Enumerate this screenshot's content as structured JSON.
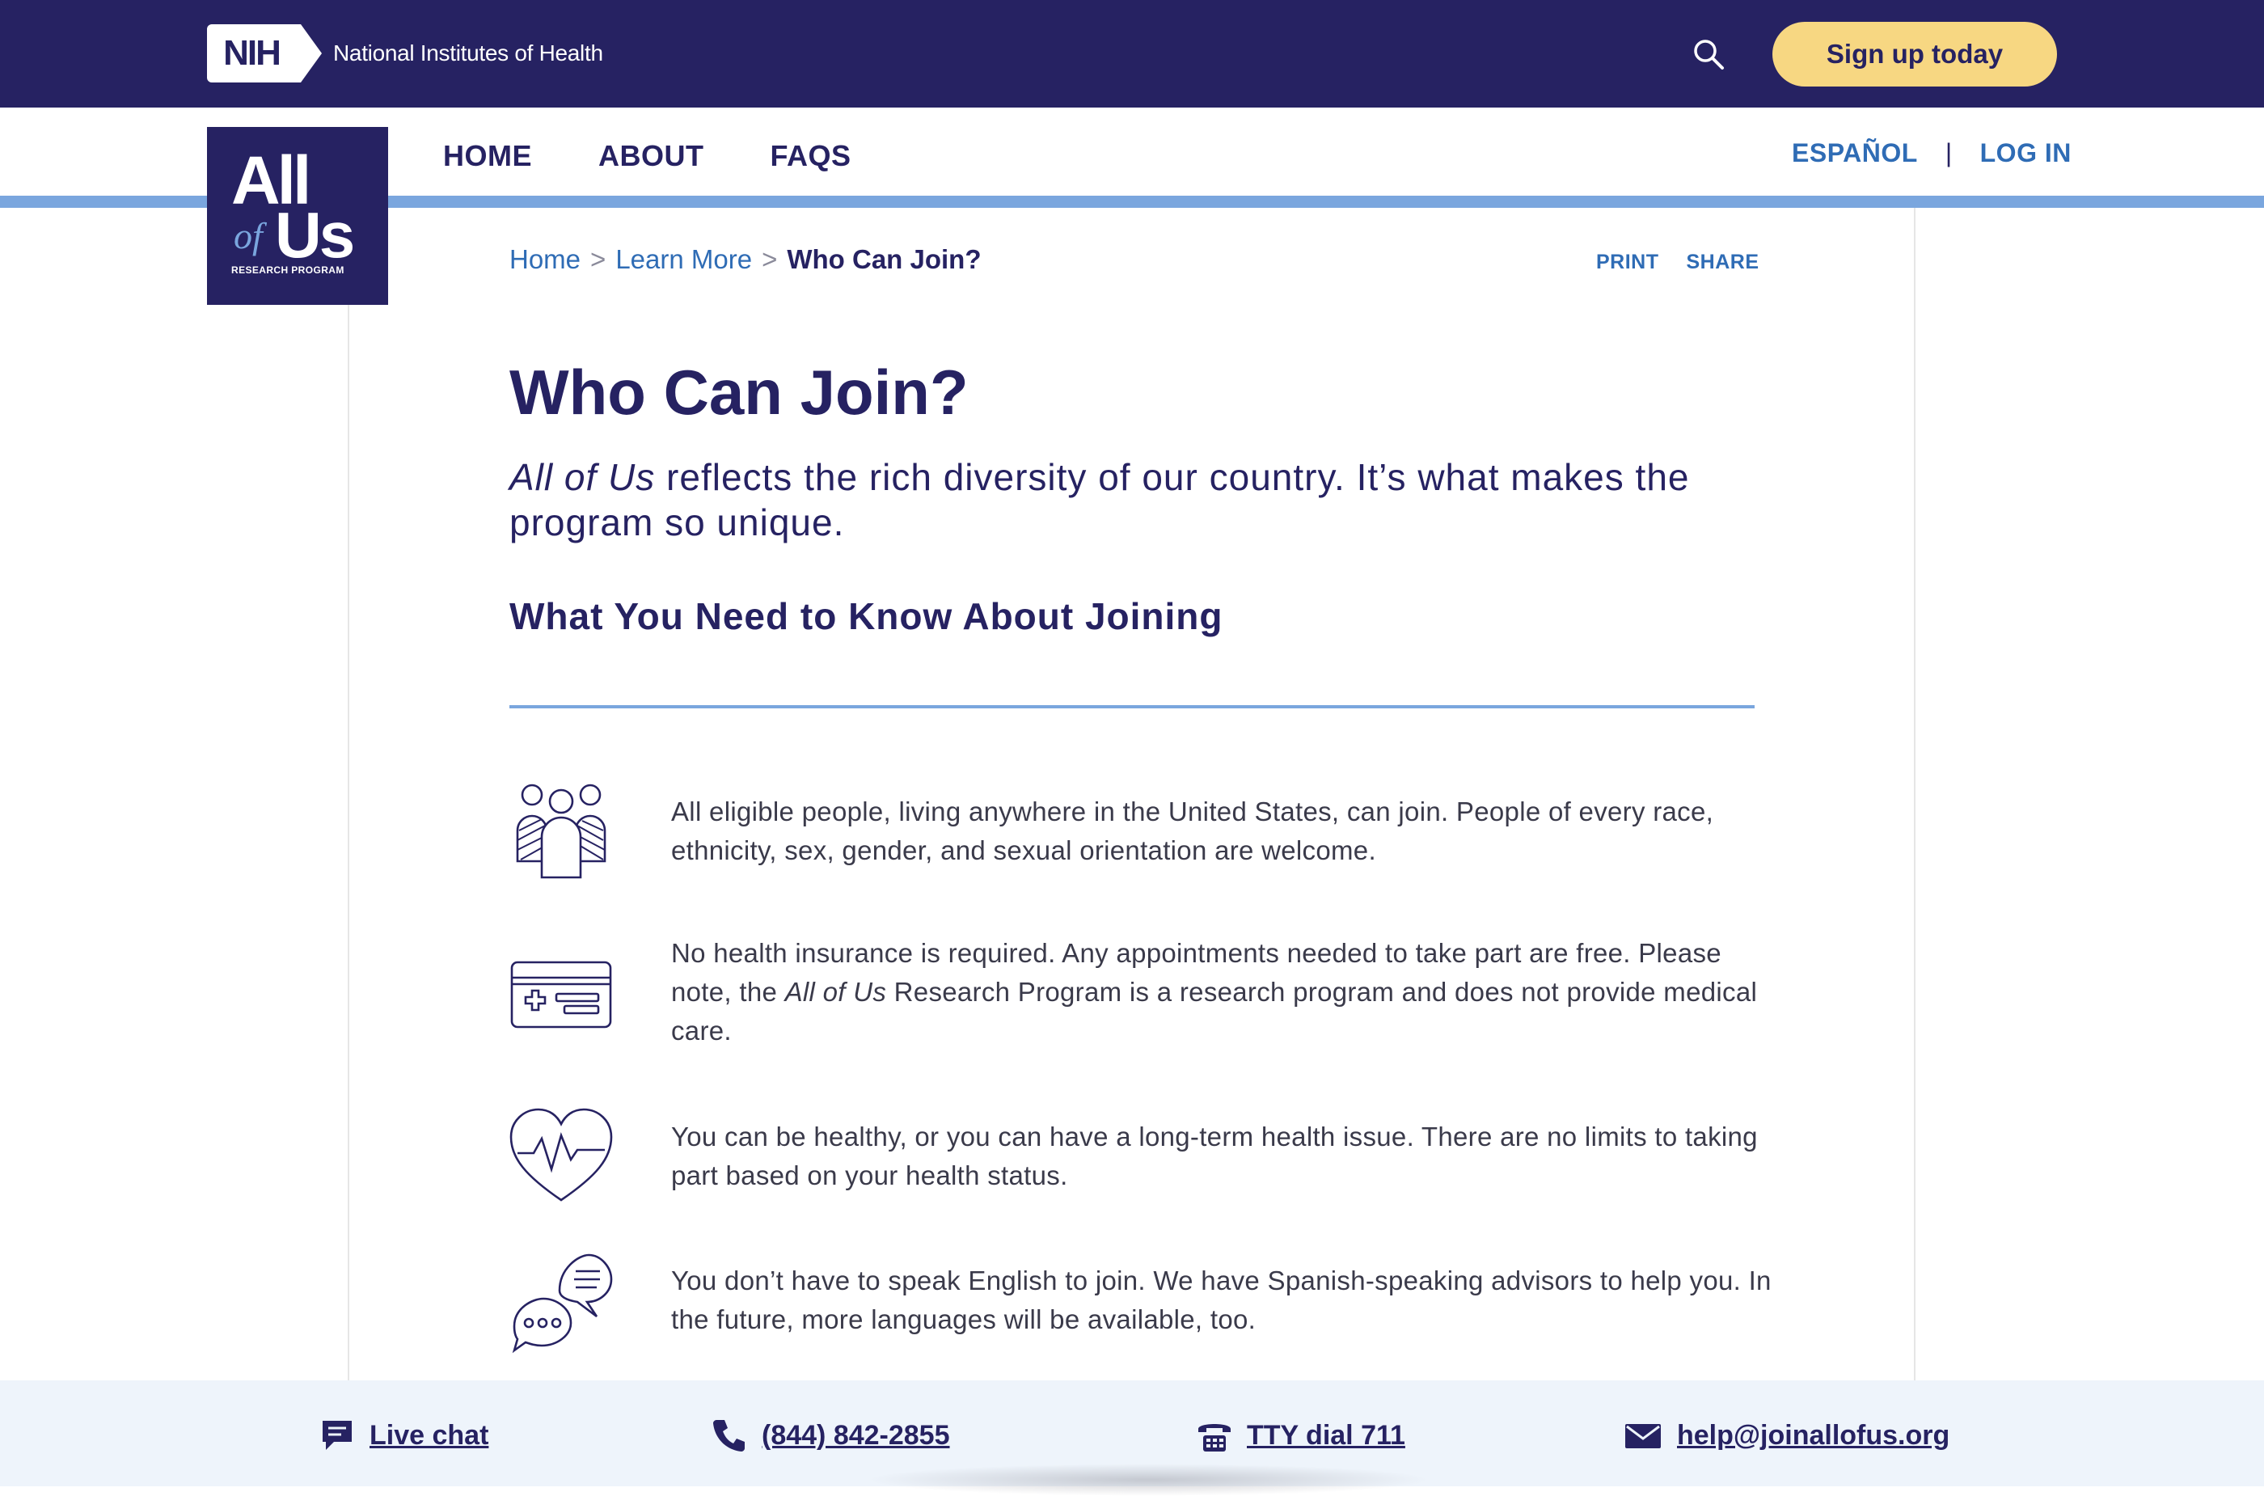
{
  "header": {
    "nih_abbr": "NIH",
    "nih_name": "National Institutes of Health",
    "signup_label": "Sign up today"
  },
  "logo": {
    "line1": "All",
    "line2a": "of",
    "line2b": "Us",
    "line3": "RESEARCH PROGRAM"
  },
  "nav": {
    "items": [
      {
        "label": "HOME"
      },
      {
        "label": "ABOUT"
      },
      {
        "label": "FAQS"
      }
    ],
    "espanol": "ESPAÑOL",
    "separator": "|",
    "login": "LOG IN"
  },
  "breadcrumb": {
    "home": "Home",
    "sep": ">",
    "learn_more": "Learn More",
    "current": "Who Can Join?"
  },
  "tools": {
    "print": "PRINT",
    "share": "SHARE"
  },
  "main": {
    "title": "Who Can Join?",
    "lede_em": "All of Us",
    "lede_rest": " reflects the rich diversity of our country. It’s what makes the program so unique.",
    "subhead": "What You Need to Know About Joining",
    "items": [
      {
        "icon": "people-icon",
        "text": "All eligible people, living anywhere in the United States, can join. People of every race, ethnicity, sex, gender, and sexual orientation are welcome."
      },
      {
        "icon": "insurance-card-icon",
        "text_a": "No health insurance is required. Any appointments needed to take part are free. Please note, the ",
        "text_em": "All of Us",
        "text_b": " Research Program is a research program and does not provide medical care."
      },
      {
        "icon": "heart-pulse-icon",
        "text": "You can be healthy, or you can have a long-term health issue. There are no limits to taking part based on your health status."
      },
      {
        "icon": "speech-bubbles-icon",
        "text": "You don’t have to speak English to join. We have Spanish-speaking advisors to help you. In the future, more languages will be available, too."
      }
    ]
  },
  "footer": {
    "live_chat": "Live chat",
    "phone": "(844) 842-2855",
    "tty": "TTY dial 711",
    "email": "help@joinallofus.org"
  },
  "colors": {
    "navy": "#262262",
    "accent_blue": "#7aa6de",
    "link_blue": "#2f6cb5",
    "signup_yellow": "#f7d782",
    "footer_bg": "#eef4fb"
  }
}
